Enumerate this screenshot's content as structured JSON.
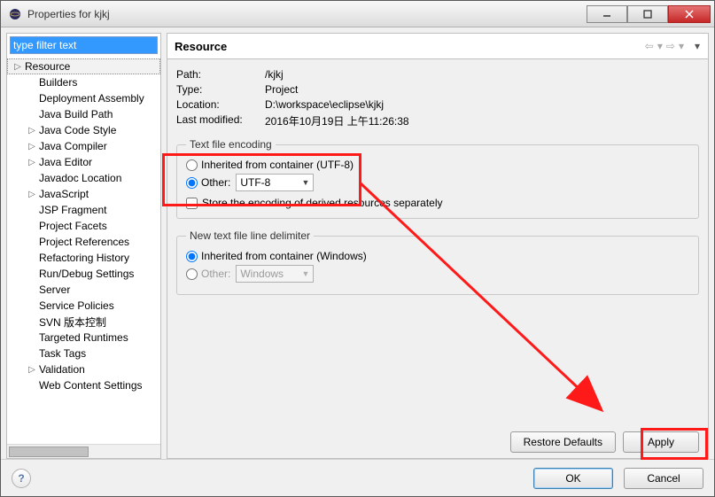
{
  "window": {
    "title": "Properties for kjkj"
  },
  "filter": {
    "placeholder": "type filter text",
    "value": "type filter text"
  },
  "tree": {
    "items": [
      {
        "label": "Resource",
        "expandable": true,
        "selected": true
      },
      {
        "label": "Builders"
      },
      {
        "label": "Deployment Assembly"
      },
      {
        "label": "Java Build Path"
      },
      {
        "label": "Java Code Style",
        "expandable": true
      },
      {
        "label": "Java Compiler",
        "expandable": true
      },
      {
        "label": "Java Editor",
        "expandable": true
      },
      {
        "label": "Javadoc Location"
      },
      {
        "label": "JavaScript",
        "expandable": true
      },
      {
        "label": "JSP Fragment"
      },
      {
        "label": "Project Facets"
      },
      {
        "label": "Project References"
      },
      {
        "label": "Refactoring History"
      },
      {
        "label": "Run/Debug Settings"
      },
      {
        "label": "Server"
      },
      {
        "label": "Service Policies"
      },
      {
        "label": "SVN 版本控制"
      },
      {
        "label": "Targeted Runtimes"
      },
      {
        "label": "Task Tags"
      },
      {
        "label": "Validation",
        "expandable": true
      },
      {
        "label": "Web Content Settings"
      }
    ]
  },
  "panel": {
    "heading": "Resource",
    "path_label": "Path:",
    "path_value": "/kjkj",
    "type_label": "Type:",
    "type_value": "Project",
    "location_label": "Location:",
    "location_value": "D:\\workspace\\eclipse\\kjkj",
    "modified_label": "Last modified:",
    "modified_value": "2016年10月19日 上午11:26:38",
    "encoding": {
      "legend": "Text file encoding",
      "inherited_label": "Inherited from container (UTF-8)",
      "other_label": "Other:",
      "other_value": "UTF-8",
      "store_label": "Store the encoding of derived resources separately"
    },
    "delimiter": {
      "legend": "New text file line delimiter",
      "inherited_label": "Inherited from container (Windows)",
      "other_label": "Other:",
      "other_value": "Windows"
    },
    "restore_defaults": "Restore Defaults",
    "apply": "Apply"
  },
  "footer": {
    "ok": "OK",
    "cancel": "Cancel"
  }
}
